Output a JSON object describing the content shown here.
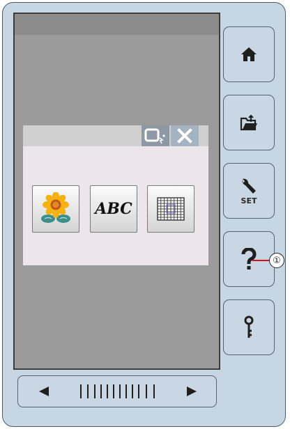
{
  "icons": {
    "hoop": "hoop-select-icon",
    "close": "close-x-icon",
    "home": "home-icon",
    "open_file": "folder-open-icon",
    "settings": "wrench-icon",
    "help": "question-mark-icon",
    "key": "key-icon",
    "built_in_designs": "sunflower-design-icon",
    "monogram": "abc-monogram-icon",
    "grid": "grid-icon",
    "scroll_left": "triangle-left-icon",
    "scroll_right": "triangle-right-icon"
  },
  "dialog": {
    "monogram_label": "ABC"
  },
  "side": {
    "set_label": "SET"
  },
  "callout": {
    "number": "①"
  },
  "colors": {
    "panel": "#c7d6e3",
    "screen": "#9b9b9b",
    "dialog": "#ece5ea",
    "accent_close": "#a3b3c1",
    "callout_line": "#d4101e"
  }
}
